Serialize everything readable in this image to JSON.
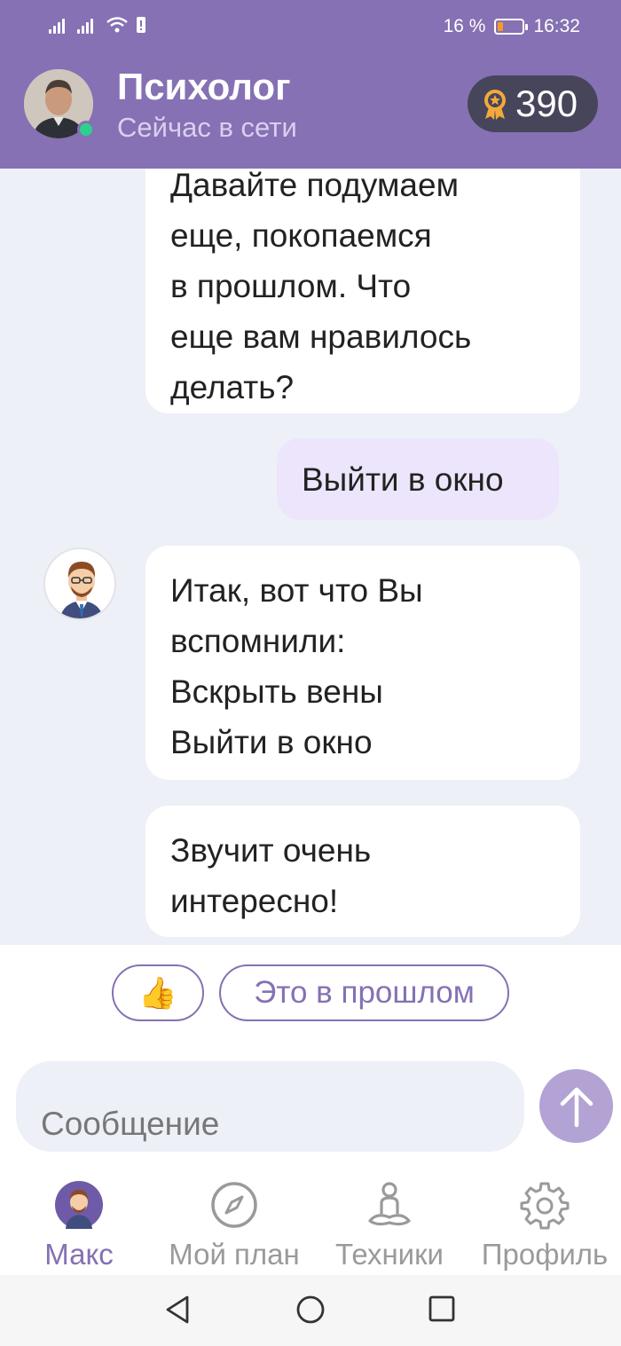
{
  "status_bar": {
    "battery_percent": "16 %",
    "time": "16:32"
  },
  "header": {
    "title": "Психолог",
    "status": "Сейчас в сети",
    "coins": "390"
  },
  "messages": [
    {
      "from": "bot",
      "lines": [
        "Давайте подумаем",
        "еще, покопаемся",
        "в прошлом. Что",
        "еще вам нравилось",
        "делать?"
      ]
    },
    {
      "from": "user",
      "lines": [
        "Выйти в окно"
      ]
    },
    {
      "from": "bot",
      "lines": [
        "Итак, вот что Вы",
        "вспомнили:",
        "Вскрыть вены",
        "Выйти в окно"
      ]
    },
    {
      "from": "bot",
      "lines": [
        "Звучит очень",
        "интересно!"
      ]
    }
  ],
  "quick_replies": [
    "👍",
    "Это в прошлом"
  ],
  "composer": {
    "placeholder": "Сообщение"
  },
  "bottom_nav": [
    {
      "label": "Макс",
      "icon": "avatar-icon",
      "active": true
    },
    {
      "label": "Мой план",
      "icon": "compass-icon",
      "active": false
    },
    {
      "label": "Техники",
      "icon": "meditation-icon",
      "active": false
    },
    {
      "label": "Профиль",
      "icon": "gear-icon",
      "active": false
    }
  ],
  "colors": {
    "header": "#8571b3",
    "accent": "#8571b3",
    "online": "#2fcf8f",
    "user_bubble": "#ece5fb",
    "chat_background": "#eef0f8"
  }
}
